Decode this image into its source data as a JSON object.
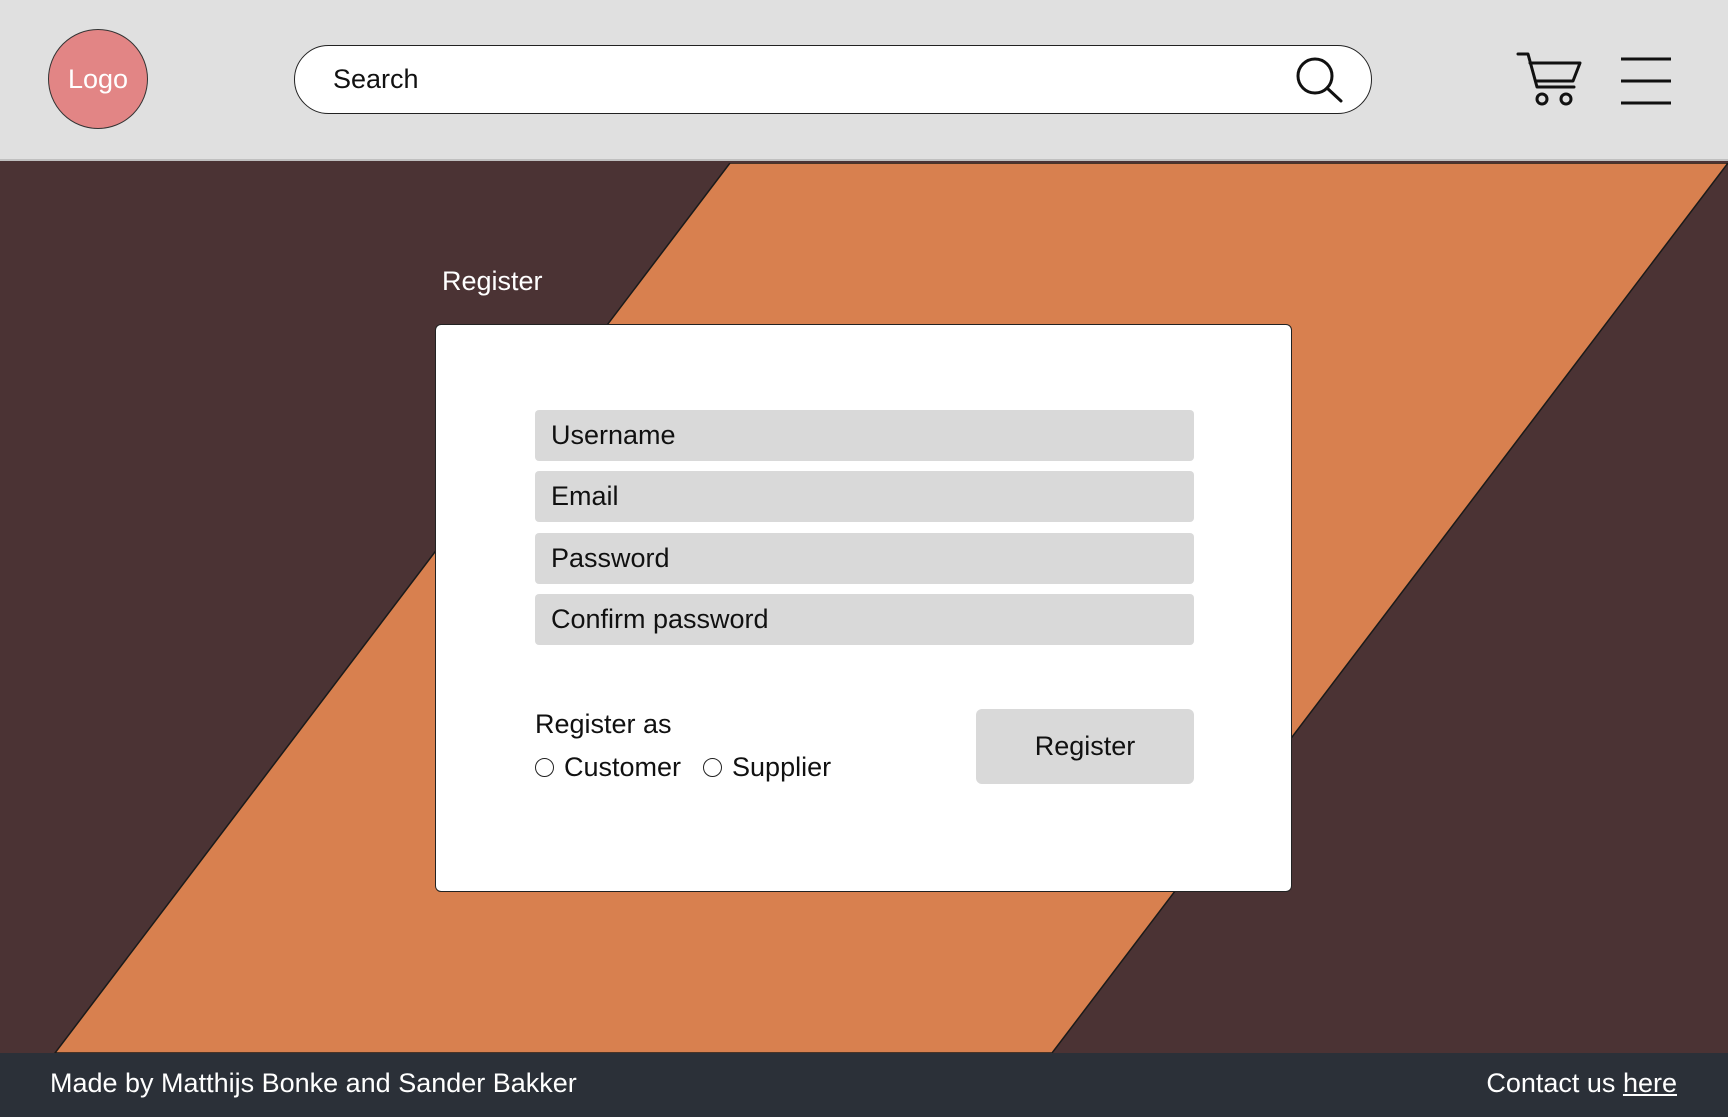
{
  "header": {
    "logo_text": "Logo",
    "search_placeholder": "Search",
    "icons": [
      "search-icon",
      "cart-icon",
      "menu-icon"
    ]
  },
  "main": {
    "title": "Register",
    "form": {
      "username_placeholder": "Username",
      "email_placeholder": "Email",
      "password_placeholder": "Password",
      "confirm_password_placeholder": "Confirm password",
      "register_as_label": "Register as",
      "role_options": [
        "Customer",
        "Supplier"
      ],
      "submit_label": "Register"
    }
  },
  "footer": {
    "credits": "Made by Matthijs Bonke and Sander Bakker",
    "contact_text": "Contact us",
    "contact_link": "here"
  },
  "colors": {
    "header_bg": "#e0e0e0",
    "logo_bg": "#e28585",
    "background_dark": "#4b3334",
    "background_orange": "#d8804f",
    "field_bg": "#d9d9d9",
    "footer_bg": "#2b3038"
  }
}
